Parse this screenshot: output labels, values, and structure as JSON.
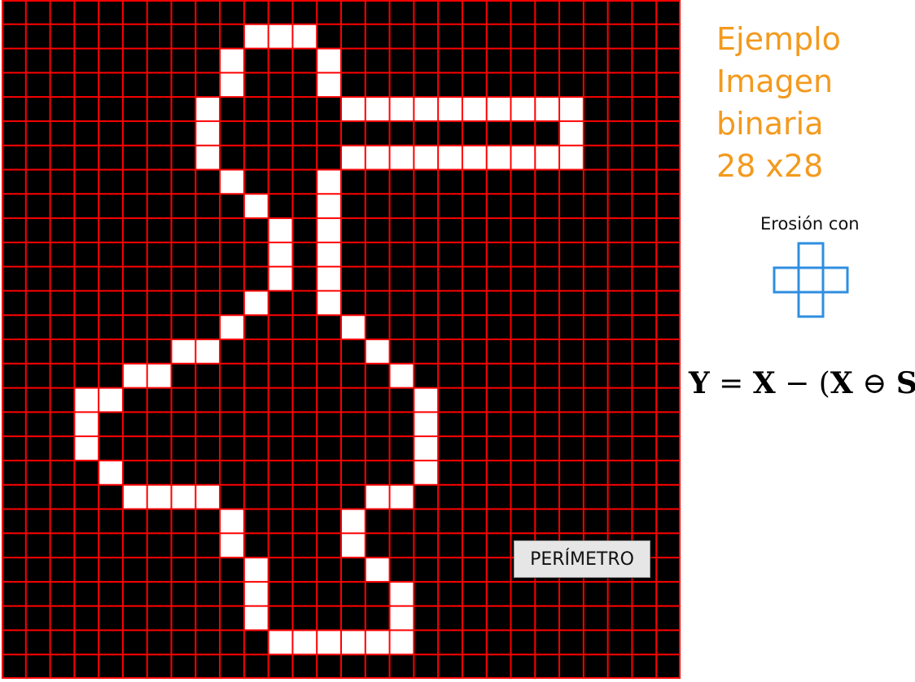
{
  "title_lines": [
    "Ejemplo",
    "Imagen",
    "binaria",
    "28 x28"
  ],
  "erosion_label": "Erosión con",
  "formula": {
    "lhs": "Y",
    "eq": "=",
    "x1": "X",
    "minus": "−",
    "open": "(",
    "x2": "X",
    "op": "⊖",
    "s": "S",
    "close": ")"
  },
  "perimeter_button": "PERÍMETRO",
  "colors": {
    "background": "#000000",
    "grid_lines": "#ff0000",
    "foreground": "#ffffff",
    "title": "#f39a1e",
    "structuring_element": "#2f8fe0"
  },
  "grid": {
    "rows": 28,
    "cols": 28,
    "white_pixels": [
      [
        1,
        10
      ],
      [
        1,
        11
      ],
      [
        1,
        12
      ],
      [
        2,
        9
      ],
      [
        2,
        13
      ],
      [
        3,
        9
      ],
      [
        3,
        13
      ],
      [
        4,
        8
      ],
      [
        4,
        14
      ],
      [
        4,
        15
      ],
      [
        4,
        16
      ],
      [
        4,
        17
      ],
      [
        4,
        18
      ],
      [
        4,
        19
      ],
      [
        4,
        20
      ],
      [
        4,
        21
      ],
      [
        4,
        22
      ],
      [
        4,
        23
      ],
      [
        5,
        8
      ],
      [
        5,
        23
      ],
      [
        6,
        8
      ],
      [
        6,
        14
      ],
      [
        6,
        15
      ],
      [
        6,
        16
      ],
      [
        6,
        17
      ],
      [
        6,
        18
      ],
      [
        6,
        19
      ],
      [
        6,
        20
      ],
      [
        6,
        21
      ],
      [
        6,
        22
      ],
      [
        6,
        23
      ],
      [
        7,
        9
      ],
      [
        7,
        13
      ],
      [
        8,
        10
      ],
      [
        8,
        13
      ],
      [
        9,
        11
      ],
      [
        9,
        13
      ],
      [
        10,
        11
      ],
      [
        10,
        13
      ],
      [
        11,
        11
      ],
      [
        11,
        13
      ],
      [
        12,
        10
      ],
      [
        12,
        13
      ],
      [
        13,
        9
      ],
      [
        13,
        14
      ],
      [
        14,
        7
      ],
      [
        14,
        8
      ],
      [
        14,
        15
      ],
      [
        15,
        5
      ],
      [
        15,
        6
      ],
      [
        15,
        16
      ],
      [
        16,
        3
      ],
      [
        16,
        4
      ],
      [
        16,
        17
      ],
      [
        17,
        3
      ],
      [
        17,
        17
      ],
      [
        18,
        3
      ],
      [
        18,
        17
      ],
      [
        19,
        4
      ],
      [
        19,
        17
      ],
      [
        20,
        5
      ],
      [
        20,
        6
      ],
      [
        20,
        7
      ],
      [
        20,
        8
      ],
      [
        20,
        15
      ],
      [
        20,
        16
      ],
      [
        21,
        9
      ],
      [
        21,
        14
      ],
      [
        22,
        9
      ],
      [
        22,
        14
      ],
      [
        23,
        10
      ],
      [
        23,
        15
      ],
      [
        24,
        10
      ],
      [
        24,
        16
      ],
      [
        25,
        10
      ],
      [
        25,
        16
      ],
      [
        26,
        11
      ],
      [
        26,
        12
      ],
      [
        26,
        13
      ],
      [
        26,
        14
      ],
      [
        26,
        15
      ],
      [
        26,
        16
      ]
    ]
  },
  "structuring_element": {
    "shape": "cross",
    "cells": [
      [
        0,
        1
      ],
      [
        1,
        0
      ],
      [
        1,
        1
      ],
      [
        1,
        2
      ],
      [
        2,
        1
      ]
    ]
  }
}
